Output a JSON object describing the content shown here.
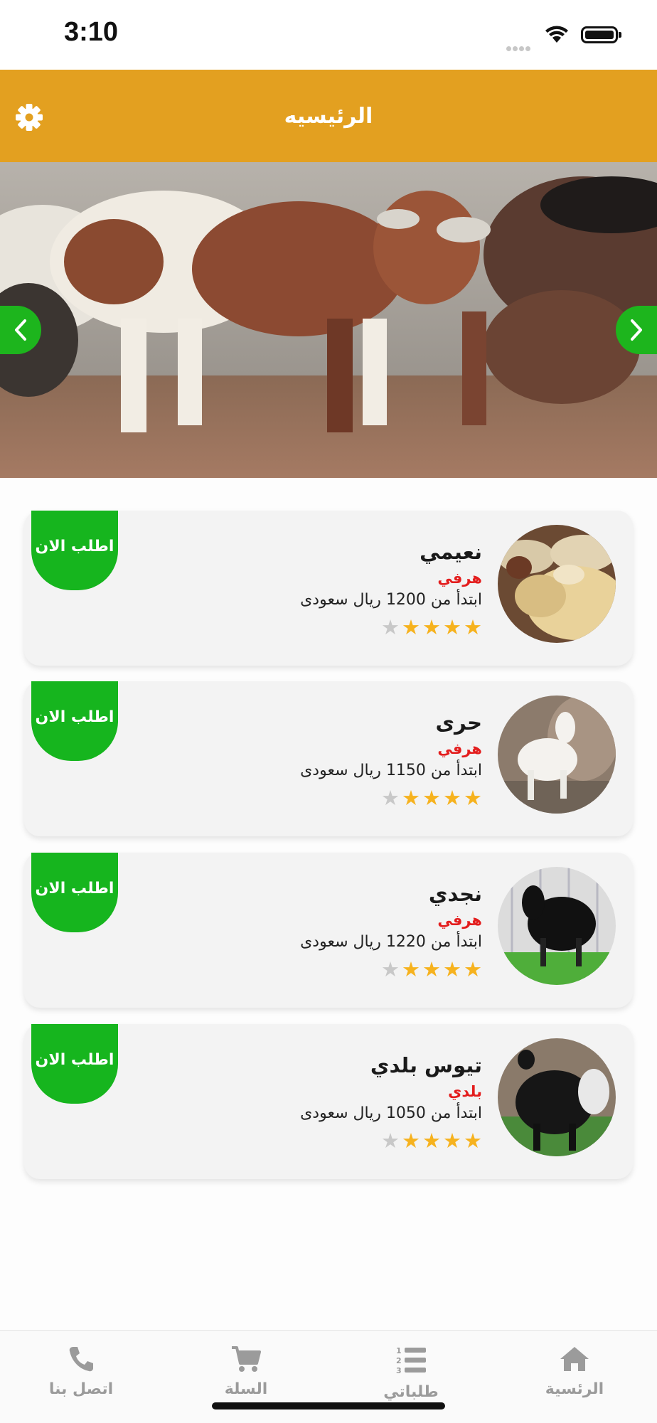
{
  "status_bar": {
    "time": "3:10"
  },
  "header": {
    "title": "الرئيسيه",
    "settings_icon": "gear-icon"
  },
  "banner": {
    "prev_icon": "chevron-left-icon",
    "next_icon": "chevron-right-icon"
  },
  "products": [
    {
      "name": "نعيمي",
      "type": "هرفي",
      "price": "ابتدأ من 1200 ريال سعودى",
      "rating": 4,
      "order_label": "اطلب الان"
    },
    {
      "name": "حرى",
      "type": "هرفي",
      "price": "ابتدأ من 1150 ريال سعودى",
      "rating": 4,
      "order_label": "اطلب الان"
    },
    {
      "name": "نجدي",
      "type": "هرفي",
      "price": "ابتدأ من 1220 ريال سعودى",
      "rating": 4,
      "order_label": "اطلب الان"
    },
    {
      "name": "تيوس بلدي",
      "type": "بلدي",
      "price": "ابتدأ من 1050 ريال سعودى",
      "rating": 4,
      "order_label": "اطلب الان"
    }
  ],
  "bottom_nav": {
    "contact": "اتصل بنا",
    "cart": "السلة",
    "orders": "طلباتي",
    "home": "الرئسية"
  },
  "colors": {
    "header": "#e3a020",
    "order_button": "#16b51e",
    "type_text": "#e31d1d",
    "star_on": "#f6b21e",
    "star_off": "#c8c8c8"
  }
}
